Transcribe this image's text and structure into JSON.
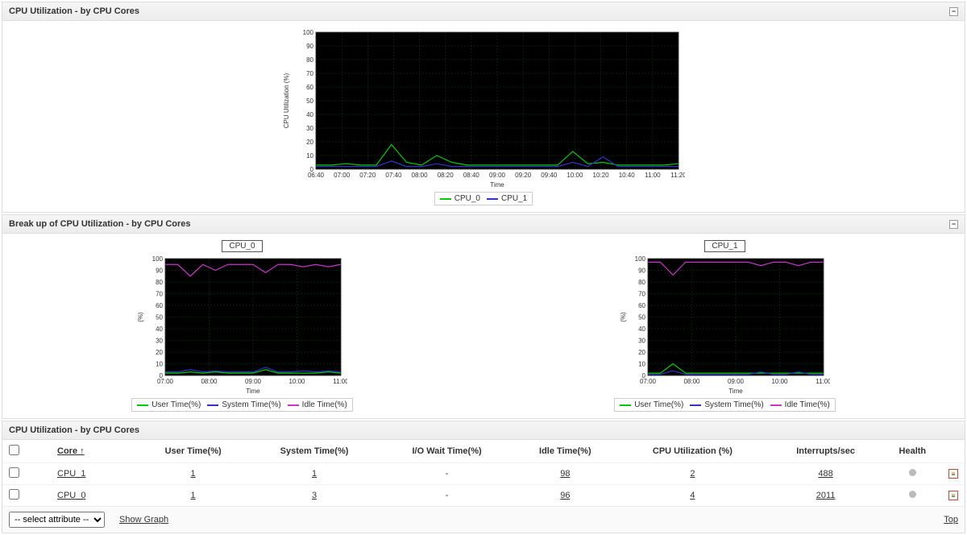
{
  "panels": {
    "main": {
      "title": "CPU Utilization - by CPU Cores"
    },
    "breakup": {
      "title": "Break up of CPU Utilization - by CPU Cores"
    },
    "table": {
      "title": "CPU Utilization - by CPU Cores"
    }
  },
  "legend": {
    "cpu0": "CPU_0",
    "cpu1": "CPU_1",
    "user": "User Time(%)",
    "system": "System Time(%)",
    "idle": "Idle Time(%)"
  },
  "colors": {
    "cpu0": "#00cc00",
    "cpu1": "#3333cc",
    "user": "#00cc00",
    "system": "#3333cc",
    "idle": "#cc33cc",
    "grid": "#114411",
    "plotbg": "#000000"
  },
  "sub_titles": {
    "cpu0": "CPU_0",
    "cpu1": "CPU_1"
  },
  "table_headers": {
    "core": "Core ↑",
    "user": "User Time(%)",
    "system": "System Time(%)",
    "iowait": "I/O Wait Time(%)",
    "idle": "Idle Time(%)",
    "util": "CPU Utilization (%)",
    "intr": "Interrupts/sec",
    "health": "Health"
  },
  "table_rows": [
    {
      "core": "CPU_1",
      "user": "1",
      "system": "1",
      "iowait": "-",
      "idle": "98",
      "util": "2",
      "intr": "488"
    },
    {
      "core": "CPU_0",
      "user": "1",
      "system": "3",
      "iowait": "-",
      "idle": "96",
      "util": "4",
      "intr": "2011"
    }
  ],
  "footer": {
    "select_placeholder": "-- select attribute --",
    "show_graph": "Show Graph",
    "top": "Top"
  },
  "chart_data": [
    {
      "type": "line",
      "title": "CPU Utilization - by CPU Cores",
      "xlabel": "Time",
      "ylabel": "CPU Utilization (%)",
      "ylim": [
        0,
        100
      ],
      "x_ticks": [
        "06:40",
        "07:00",
        "07:20",
        "07:40",
        "08:00",
        "08:20",
        "08:40",
        "09:00",
        "09:20",
        "09:40",
        "10:00",
        "10:20",
        "10:40",
        "11:00",
        "11:20"
      ],
      "x": [
        400,
        412,
        424,
        436,
        448,
        460,
        472,
        484,
        496,
        508,
        520,
        532,
        544,
        556,
        568,
        580,
        592,
        604,
        616,
        628,
        640,
        652,
        664,
        676,
        688
      ],
      "series": [
        {
          "name": "CPU_0",
          "color": "#00cc00",
          "values": [
            3,
            3,
            4,
            3,
            3,
            18,
            5,
            3,
            10,
            5,
            3,
            3,
            3,
            3,
            3,
            3,
            3,
            13,
            4,
            5,
            3,
            3,
            3,
            3,
            4
          ]
        },
        {
          "name": "CPU_1",
          "color": "#3333cc",
          "values": [
            2,
            2,
            2,
            2,
            2,
            6,
            2,
            2,
            4,
            2,
            2,
            2,
            2,
            2,
            2,
            2,
            2,
            5,
            2,
            9,
            2,
            2,
            2,
            2,
            2
          ]
        }
      ]
    },
    {
      "type": "line",
      "title": "CPU_0",
      "xlabel": "Time",
      "ylabel": "(%)",
      "ylim": [
        0,
        100
      ],
      "x_ticks": [
        "07:00",
        "08:00",
        "09:00",
        "10:00",
        "11:00"
      ],
      "x": [
        400,
        420,
        440,
        460,
        480,
        500,
        520,
        540,
        560,
        580,
        600,
        620,
        640,
        660,
        680
      ],
      "series": [
        {
          "name": "User Time(%)",
          "color": "#00cc00",
          "values": [
            2,
            2,
            3,
            2,
            3,
            2,
            2,
            2,
            5,
            2,
            2,
            2,
            2,
            3,
            2
          ]
        },
        {
          "name": "System Time(%)",
          "color": "#3333cc",
          "values": [
            3,
            3,
            5,
            3,
            4,
            3,
            3,
            3,
            7,
            3,
            3,
            4,
            3,
            4,
            3
          ]
        },
        {
          "name": "Idle Time(%)",
          "color": "#cc33cc",
          "values": [
            95,
            95,
            85,
            95,
            90,
            95,
            95,
            95,
            88,
            95,
            95,
            93,
            95,
            93,
            95
          ]
        }
      ]
    },
    {
      "type": "line",
      "title": "CPU_1",
      "xlabel": "Time",
      "ylabel": "(%)",
      "ylim": [
        0,
        100
      ],
      "x_ticks": [
        "07:00",
        "08:00",
        "09:00",
        "10:00",
        "11:00"
      ],
      "x": [
        400,
        420,
        440,
        460,
        480,
        500,
        520,
        540,
        560,
        580,
        600,
        620,
        640,
        660,
        680
      ],
      "series": [
        {
          "name": "User Time(%)",
          "color": "#00cc00",
          "values": [
            2,
            2,
            10,
            2,
            2,
            2,
            2,
            2,
            2,
            2,
            2,
            2,
            2,
            2,
            2
          ]
        },
        {
          "name": "System Time(%)",
          "color": "#3333cc",
          "values": [
            1,
            1,
            4,
            1,
            1,
            1,
            1,
            1,
            1,
            3,
            1,
            1,
            3,
            1,
            1
          ]
        },
        {
          "name": "Idle Time(%)",
          "color": "#cc33cc",
          "values": [
            97,
            97,
            86,
            97,
            97,
            97,
            97,
            97,
            97,
            94,
            97,
            97,
            94,
            97,
            97
          ]
        }
      ]
    }
  ]
}
